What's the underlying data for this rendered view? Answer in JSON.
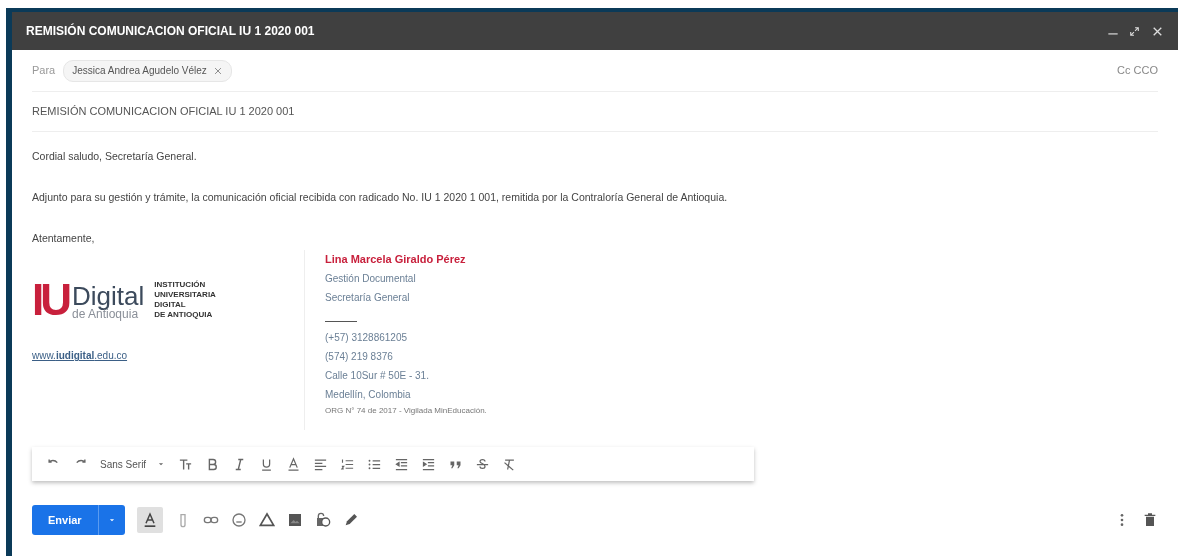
{
  "window": {
    "title": "REMISIÓN COMUNICACION OFICIAL IU 1 2020 001"
  },
  "recipients": {
    "label": "Para",
    "chips": [
      "Jessica Andrea Agudelo Vélez"
    ],
    "cc_bcc": "Cc CCO"
  },
  "subject": "REMISIÓN COMUNICACION OFICIAL IU 1 2020 001",
  "body": [
    "Cordial saludo, Secretaría General.",
    "Adjunto para su gestión y trámite, la comunicación oficial recibida con radicado No. IU 1 2020 1 001, remitida por la Contraloría General de Antioquia.",
    "Atentamente,"
  ],
  "signature": {
    "logo": {
      "mark": "IU",
      "word": "Digital",
      "place": "de Antioquia",
      "tagline": [
        "INSTITUCIÓN",
        "UNIVERSITARIA",
        "DIGITAL",
        "DE ANTIOQUIA"
      ]
    },
    "website": "www.**iudigital**.edu.co",
    "name": "Lina Marcela Giraldo Pérez",
    "lines": [
      "Gestión Documental",
      "Secretaría General"
    ],
    "contact": [
      "(+57) 3128861205",
      "(574) 219 8376",
      "Calle 10Sur # 50E - 31.",
      "Medellín, Colombia"
    ],
    "footnote": "ORG N° 74 de 2017 - Vigilada MinEducación."
  },
  "format_toolbar": {
    "font": "Sans Serif"
  },
  "send_button": "Enviar",
  "format_toggle": {
    "selected": true
  }
}
